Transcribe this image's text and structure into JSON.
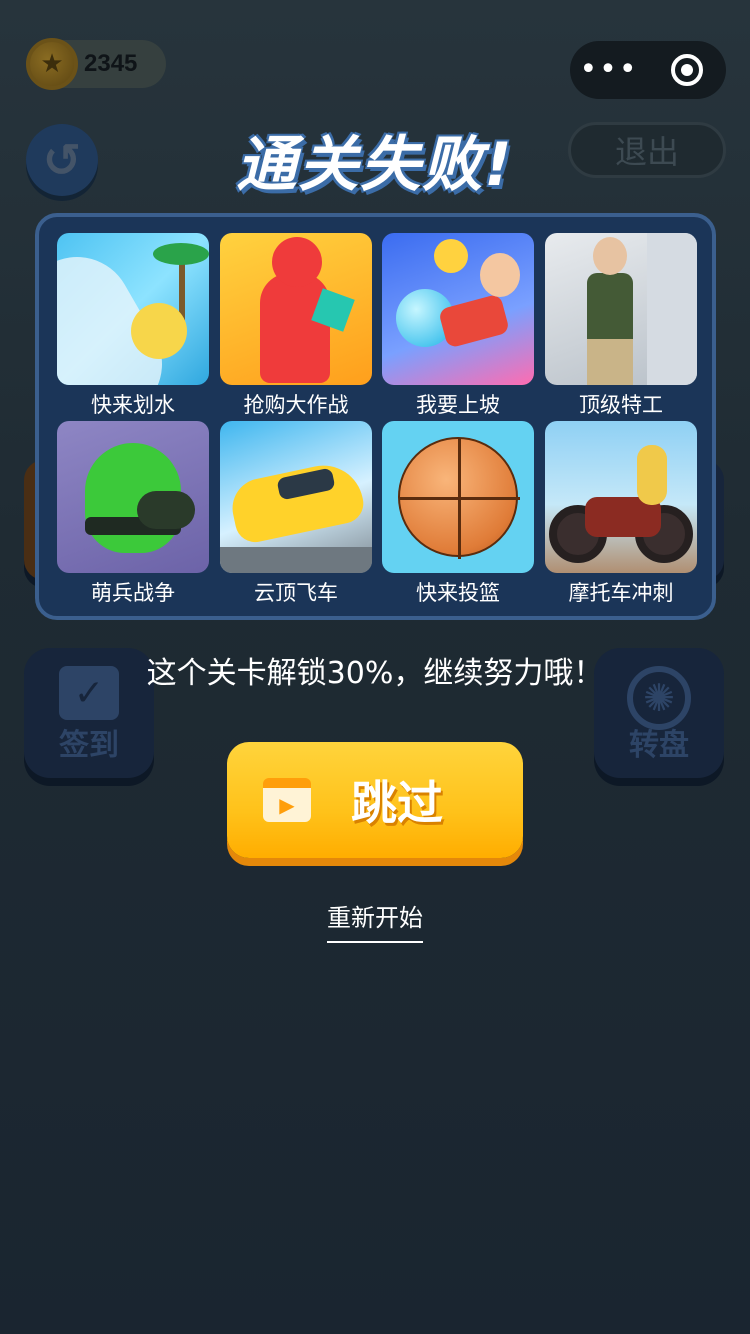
{
  "hud": {
    "coin_count": "2345",
    "menu_dots": "•••"
  },
  "top": {
    "exit_label": "退出",
    "title": "通关失败!"
  },
  "games": [
    {
      "name": "快来划水"
    },
    {
      "name": "抢购大作战"
    },
    {
      "name": "我要上坡"
    },
    {
      "name": "顶级特工"
    },
    {
      "name": "萌兵战争"
    },
    {
      "name": "云顶飞车"
    },
    {
      "name": "快来投篮"
    },
    {
      "name": "摩托车冲刺"
    }
  ],
  "side": {
    "signin_label": "签到",
    "wheel_label": "转盘"
  },
  "message": "这个关卡解锁30%，继续努力哦！",
  "skip_label": "跳过",
  "restart_label": "重新开始",
  "colors": {
    "background": "#1a2530",
    "card": "#1b3558",
    "card_border": "#3b5f8e",
    "skip_button": "#ffc21a",
    "title_shadow": "#3b6ca7"
  }
}
